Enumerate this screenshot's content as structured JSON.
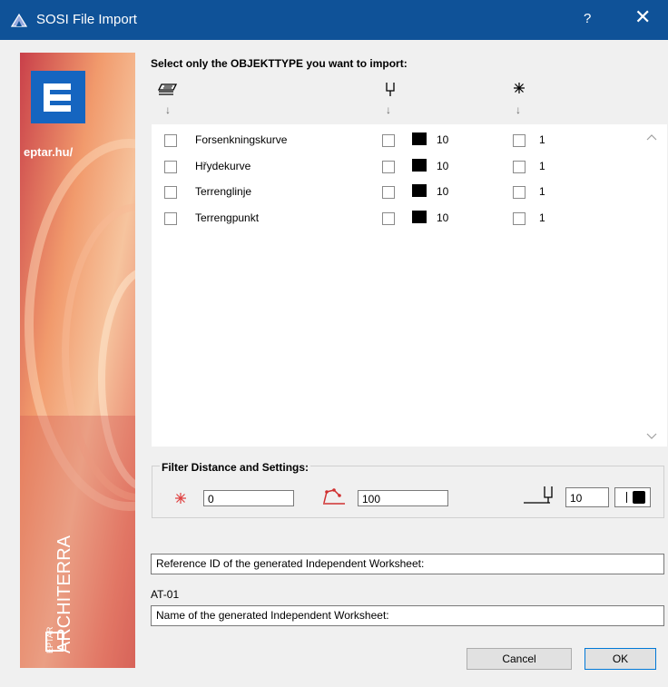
{
  "window": {
    "title": "SOSI File Import",
    "help_label": "?",
    "close_label": "✕"
  },
  "sidebar": {
    "url_text": "eptar.hu/",
    "brand_small": "EPTAR",
    "brand_large": "ARCHITERRA"
  },
  "list_section": {
    "heading": "Select only the OBJEKTTYPE you want to import:",
    "column_icons": [
      "layers-icon",
      "pen-icon",
      "asterisk-icon"
    ],
    "arrow": "↓",
    "rows": [
      {
        "name": "Forsenkningskurve",
        "pen": "10",
        "point": "1"
      },
      {
        "name": "Hřydekurve",
        "pen": "10",
        "point": "1"
      },
      {
        "name": "Terrenglinje",
        "pen": "10",
        "point": "1"
      },
      {
        "name": "Terrengpunkt",
        "pen": "10",
        "point": "1"
      }
    ],
    "scroll_up": "^",
    "scroll_down": "v"
  },
  "filter": {
    "title": "Filter Distance and Settings:",
    "distance_value": "0",
    "polyline_value": "100",
    "pen_value": "10"
  },
  "worksheet": {
    "reference_label": "Reference ID of the generated Independent Worksheet:",
    "reference_value": "AT-01",
    "name_label": "Name of the generated Independent Worksheet:"
  },
  "buttons": {
    "cancel": "Cancel",
    "ok": "OK"
  },
  "colors": {
    "titlebar": "#0f5298",
    "sidebar_accent": "#e0563f",
    "logo_blue": "#1565c0"
  }
}
